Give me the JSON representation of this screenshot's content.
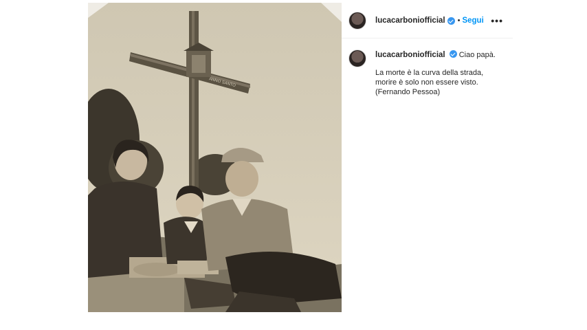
{
  "post": {
    "author": {
      "username": "lucacarboniofficial",
      "verified": true,
      "avatar": "avatar-image"
    },
    "header": {
      "separator": "•",
      "follow_label": "Segui",
      "more_icon": "more-options-icon",
      "more_label": "•••"
    },
    "caption": {
      "first_line": "Ciao papà.",
      "lines": [
        "La morte è la curva della strada,",
        "morire è solo non essere visto.",
        "(Fernando Pessoa)"
      ]
    },
    "photo": {
      "description_icon": "vintage-family-photo",
      "cross_inscription": "ANNO SANTO"
    },
    "colors": {
      "accent": "#0095f6",
      "verified": "#3897f0",
      "text": "#262626"
    }
  }
}
